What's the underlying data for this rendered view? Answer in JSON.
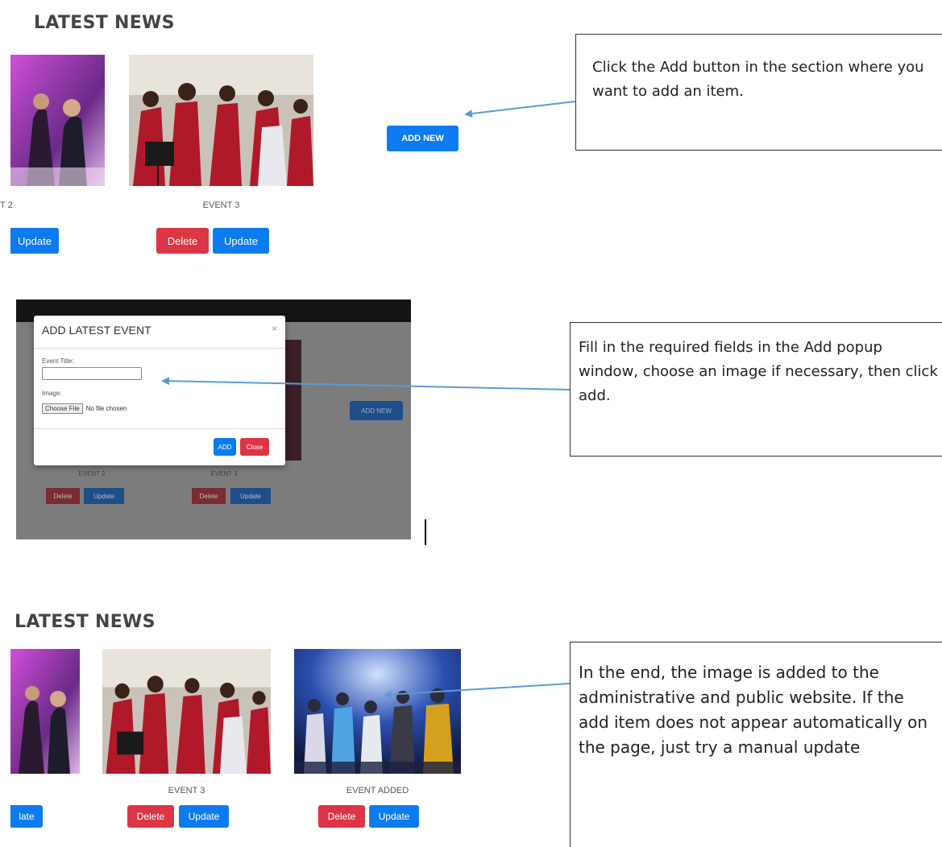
{
  "section1": {
    "heading": "LATEST NEWS",
    "captions": [
      "T 2",
      "EVENT 3"
    ],
    "buttons": {
      "update_partial": "Update",
      "delete": "Delete",
      "update": "Update",
      "add_new": "ADD NEW"
    }
  },
  "note1": {
    "text": "Click the Add button in the section where you want to add an item."
  },
  "modal_shot": {
    "title": "ADD LATEST EVENT",
    "close_x": "×",
    "event_title_label": "Event Title:",
    "event_title_value": "",
    "image_label": "Image:",
    "choose_file": "Choose File",
    "no_file": "No file chosen",
    "add": "ADD",
    "close": "Close",
    "bg_add_new": "ADD NEW",
    "bg_captions": [
      "EVENT 2",
      "EVENT 3"
    ],
    "bg_delete": "Delete",
    "bg_update": "Update"
  },
  "note2": {
    "text": "Fill in the required fields in the Add popup window, choose an image if necessary, then click add."
  },
  "section3": {
    "heading": "LATEST NEWS",
    "captions": [
      "EVENT 3",
      "EVENT ADDED"
    ],
    "buttons": {
      "update_partial": "late",
      "delete": "Delete",
      "update": "Update"
    }
  },
  "note3": {
    "text": "In the end, the image is added to the administrative and public website. If the add item does not appear automatically on the page, just try a manual update"
  },
  "colors": {
    "danger": "#dc3545",
    "primary": "#0d7bf0",
    "arrow": "#5b9bd5"
  }
}
